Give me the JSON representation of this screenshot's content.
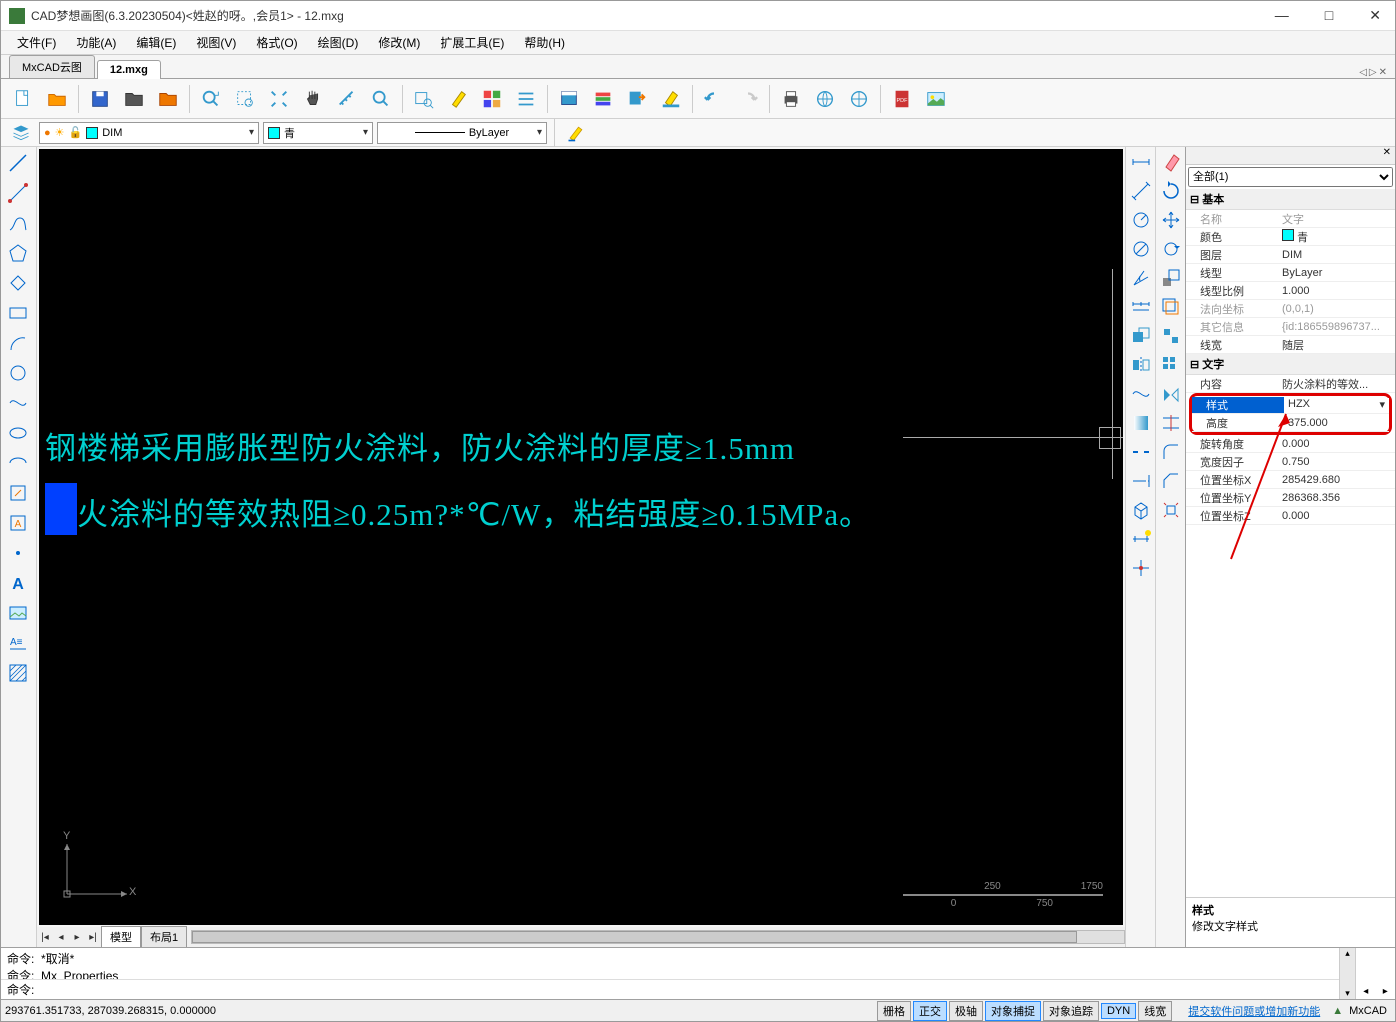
{
  "window": {
    "title": "CAD梦想画图(6.3.20230504)<姓赵的呀。,会员1> - 12.mxg"
  },
  "menu": {
    "file": "文件(F)",
    "function": "功能(A)",
    "edit": "编辑(E)",
    "view": "视图(V)",
    "format": "格式(O)",
    "draw": "绘图(D)",
    "modify": "修改(M)",
    "ext": "扩展工具(E)",
    "help": "帮助(H)"
  },
  "tabs": {
    "t1": "MxCAD云图",
    "t2": "12.mxg"
  },
  "layerbar": {
    "layer": "DIM",
    "color_name": "青",
    "linetype": "ByLayer"
  },
  "canvas": {
    "line1": "钢楼梯采用膨胀型防火涂料，防火涂料的厚度≥1.5mm",
    "line2": "防火涂料的等效热阻≥0.25m?*℃/W，粘结强度≥0.15MPa。",
    "ucs_x": "X",
    "ucs_y": "Y",
    "scale_a": "250",
    "scale_b": "1750",
    "scale_c": "0",
    "scale_d": "750"
  },
  "model_tabs": {
    "model": "模型",
    "layout1": "布局1"
  },
  "properties": {
    "filter": "全部(1)",
    "grp_basic": "基本",
    "name_k": "名称",
    "name_v": "文字",
    "color_k": "颜色",
    "color_v": "青",
    "layer_k": "图层",
    "layer_v": "DIM",
    "ltype_k": "线型",
    "ltype_v": "ByLayer",
    "ltscale_k": "线型比例",
    "ltscale_v": "1.000",
    "normal_k": "法向坐标",
    "normal_v": "(0,0,1)",
    "other_k": "其它信息",
    "other_v": "{id:186559896737...",
    "lweight_k": "线宽",
    "lweight_v": "随层",
    "grp_text": "文字",
    "content_k": "内容",
    "content_v": "防火涂料的等效...",
    "style_k": "样式",
    "style_v": "HZX",
    "height_k": "高度",
    "height_v": "375.000",
    "rot_k": "旋转角度",
    "rot_v": "0.000",
    "wfac_k": "宽度因子",
    "wfac_v": "0.750",
    "posx_k": "位置坐标X",
    "posx_v": "285429.680",
    "posy_k": "位置坐标Y",
    "posy_v": "286368.356",
    "posz_k": "位置坐标Z",
    "posz_v": "0.000",
    "desc_title": "样式",
    "desc_text": "修改文字样式"
  },
  "command": {
    "label": "命令:",
    "line1": "*取消*",
    "line2": "Mx_Properties"
  },
  "status": {
    "coords": "293761.351733,  287039.268315,  0.000000",
    "grid": "栅格",
    "ortho": "正交",
    "polar": "极轴",
    "osnap": "对象捕捉",
    "otrack": "对象追踪",
    "dyn": "DYN",
    "lw": "线宽",
    "feedback": "提交软件问题或增加新功能",
    "brand": "MxCAD"
  }
}
